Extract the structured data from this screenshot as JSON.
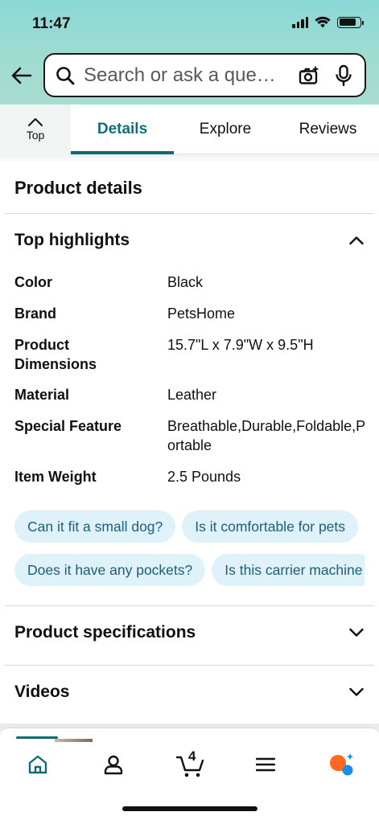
{
  "status_bar": {
    "time": "11:47"
  },
  "search": {
    "placeholder": "Search or ask a que…"
  },
  "tabs": {
    "top_label": "Top",
    "items": [
      {
        "label": "Details",
        "active": true
      },
      {
        "label": "Explore",
        "active": false
      },
      {
        "label": "Reviews",
        "active": false
      }
    ]
  },
  "product_details": {
    "title": "Product details",
    "top_highlights": {
      "title": "Top highlights",
      "rows": [
        {
          "key": "Color",
          "value": "Black"
        },
        {
          "key": "Brand",
          "value": "PetsHome"
        },
        {
          "key": "Product Dimensions",
          "value": "15.7\"L x 7.9\"W x 9.5\"H"
        },
        {
          "key": "Material",
          "value": "Leather"
        },
        {
          "key": "Special Feature",
          "value": "Breathable,Durable,Foldable,Portable"
        },
        {
          "key": "Item Weight",
          "value": "2.5 Pounds"
        }
      ]
    },
    "questions": [
      [
        "Can it fit a small dog?",
        "Is it comfortable for pets"
      ],
      [
        "Does it have any pockets?",
        "Is this carrier machine"
      ]
    ],
    "specifications_title": "Product specifications",
    "videos_title": "Videos"
  },
  "bottom_nav": {
    "cart_count": "4"
  },
  "colors": {
    "accent": "#0e6978",
    "chip_bg": "#dff1f9",
    "chip_text": "#1c5f7a",
    "header_gradient": "#8ad8d8"
  },
  "icons": [
    "back-arrow-icon",
    "search-icon",
    "camera-sparkle-icon",
    "microphone-icon",
    "chevron-up-icon",
    "chevron-down-icon",
    "home-icon",
    "account-icon",
    "cart-icon",
    "menu-icon",
    "rufus-ai-icon"
  ]
}
